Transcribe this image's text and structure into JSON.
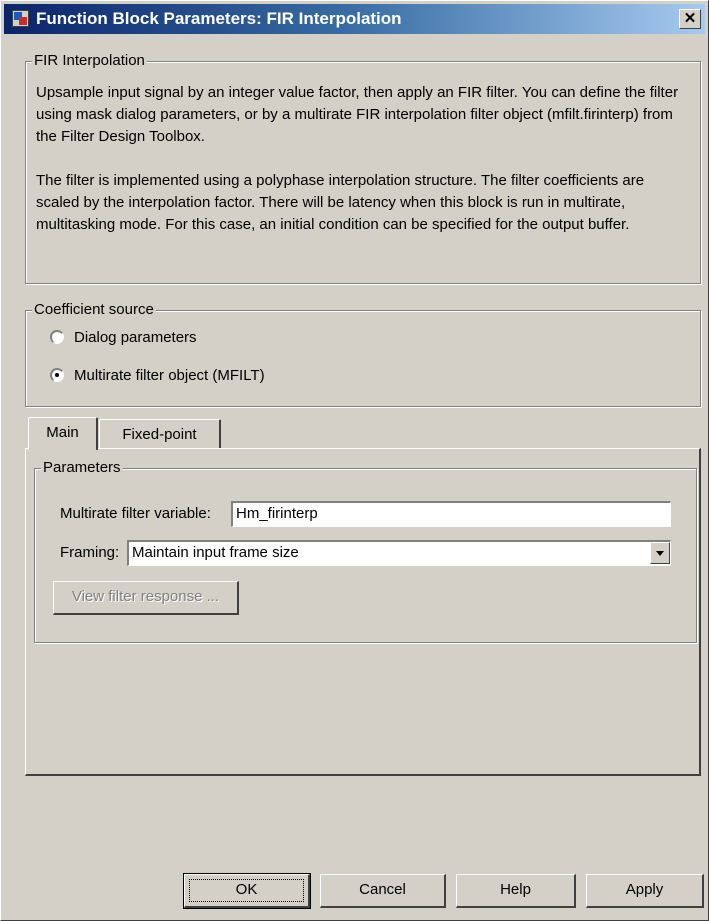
{
  "window": {
    "title": "Function Block Parameters: FIR Interpolation",
    "close_label": "✕"
  },
  "description": {
    "group_label": "FIR Interpolation",
    "paragraph1": "Upsample input signal by an integer value factor, then apply an FIR filter. You can define the filter using mask dialog parameters, or by a multirate FIR interpolation filter object (mfilt.firinterp) from the Filter Design Toolbox.",
    "paragraph2": "The filter is implemented using a polyphase interpolation structure. The filter coefficients are scaled by the interpolation factor. There will be latency when this block is run in multirate, multitasking mode. For this case, an initial condition can be specified for the output buffer."
  },
  "coefficient_source": {
    "group_label": "Coefficient source",
    "options": [
      {
        "label": "Dialog parameters",
        "selected": false
      },
      {
        "label": "Multirate filter object (MFILT)",
        "selected": true
      }
    ]
  },
  "tabs": [
    {
      "label": "Main",
      "active": true
    },
    {
      "label": "Fixed-point",
      "active": false
    }
  ],
  "parameters": {
    "group_label": "Parameters",
    "filter_variable_label": "Multirate filter variable:",
    "filter_variable_value": "Hm_firinterp",
    "framing_label": "Framing:",
    "framing_value": "Maintain input frame size",
    "view_response_label": "View filter response ..."
  },
  "buttons": {
    "ok": "OK",
    "cancel": "Cancel",
    "help": "Help",
    "apply": "Apply"
  },
  "colors": {
    "face": "#d4d0c8",
    "titlebar_start": "#0a246a",
    "titlebar_end": "#a6caf0"
  }
}
